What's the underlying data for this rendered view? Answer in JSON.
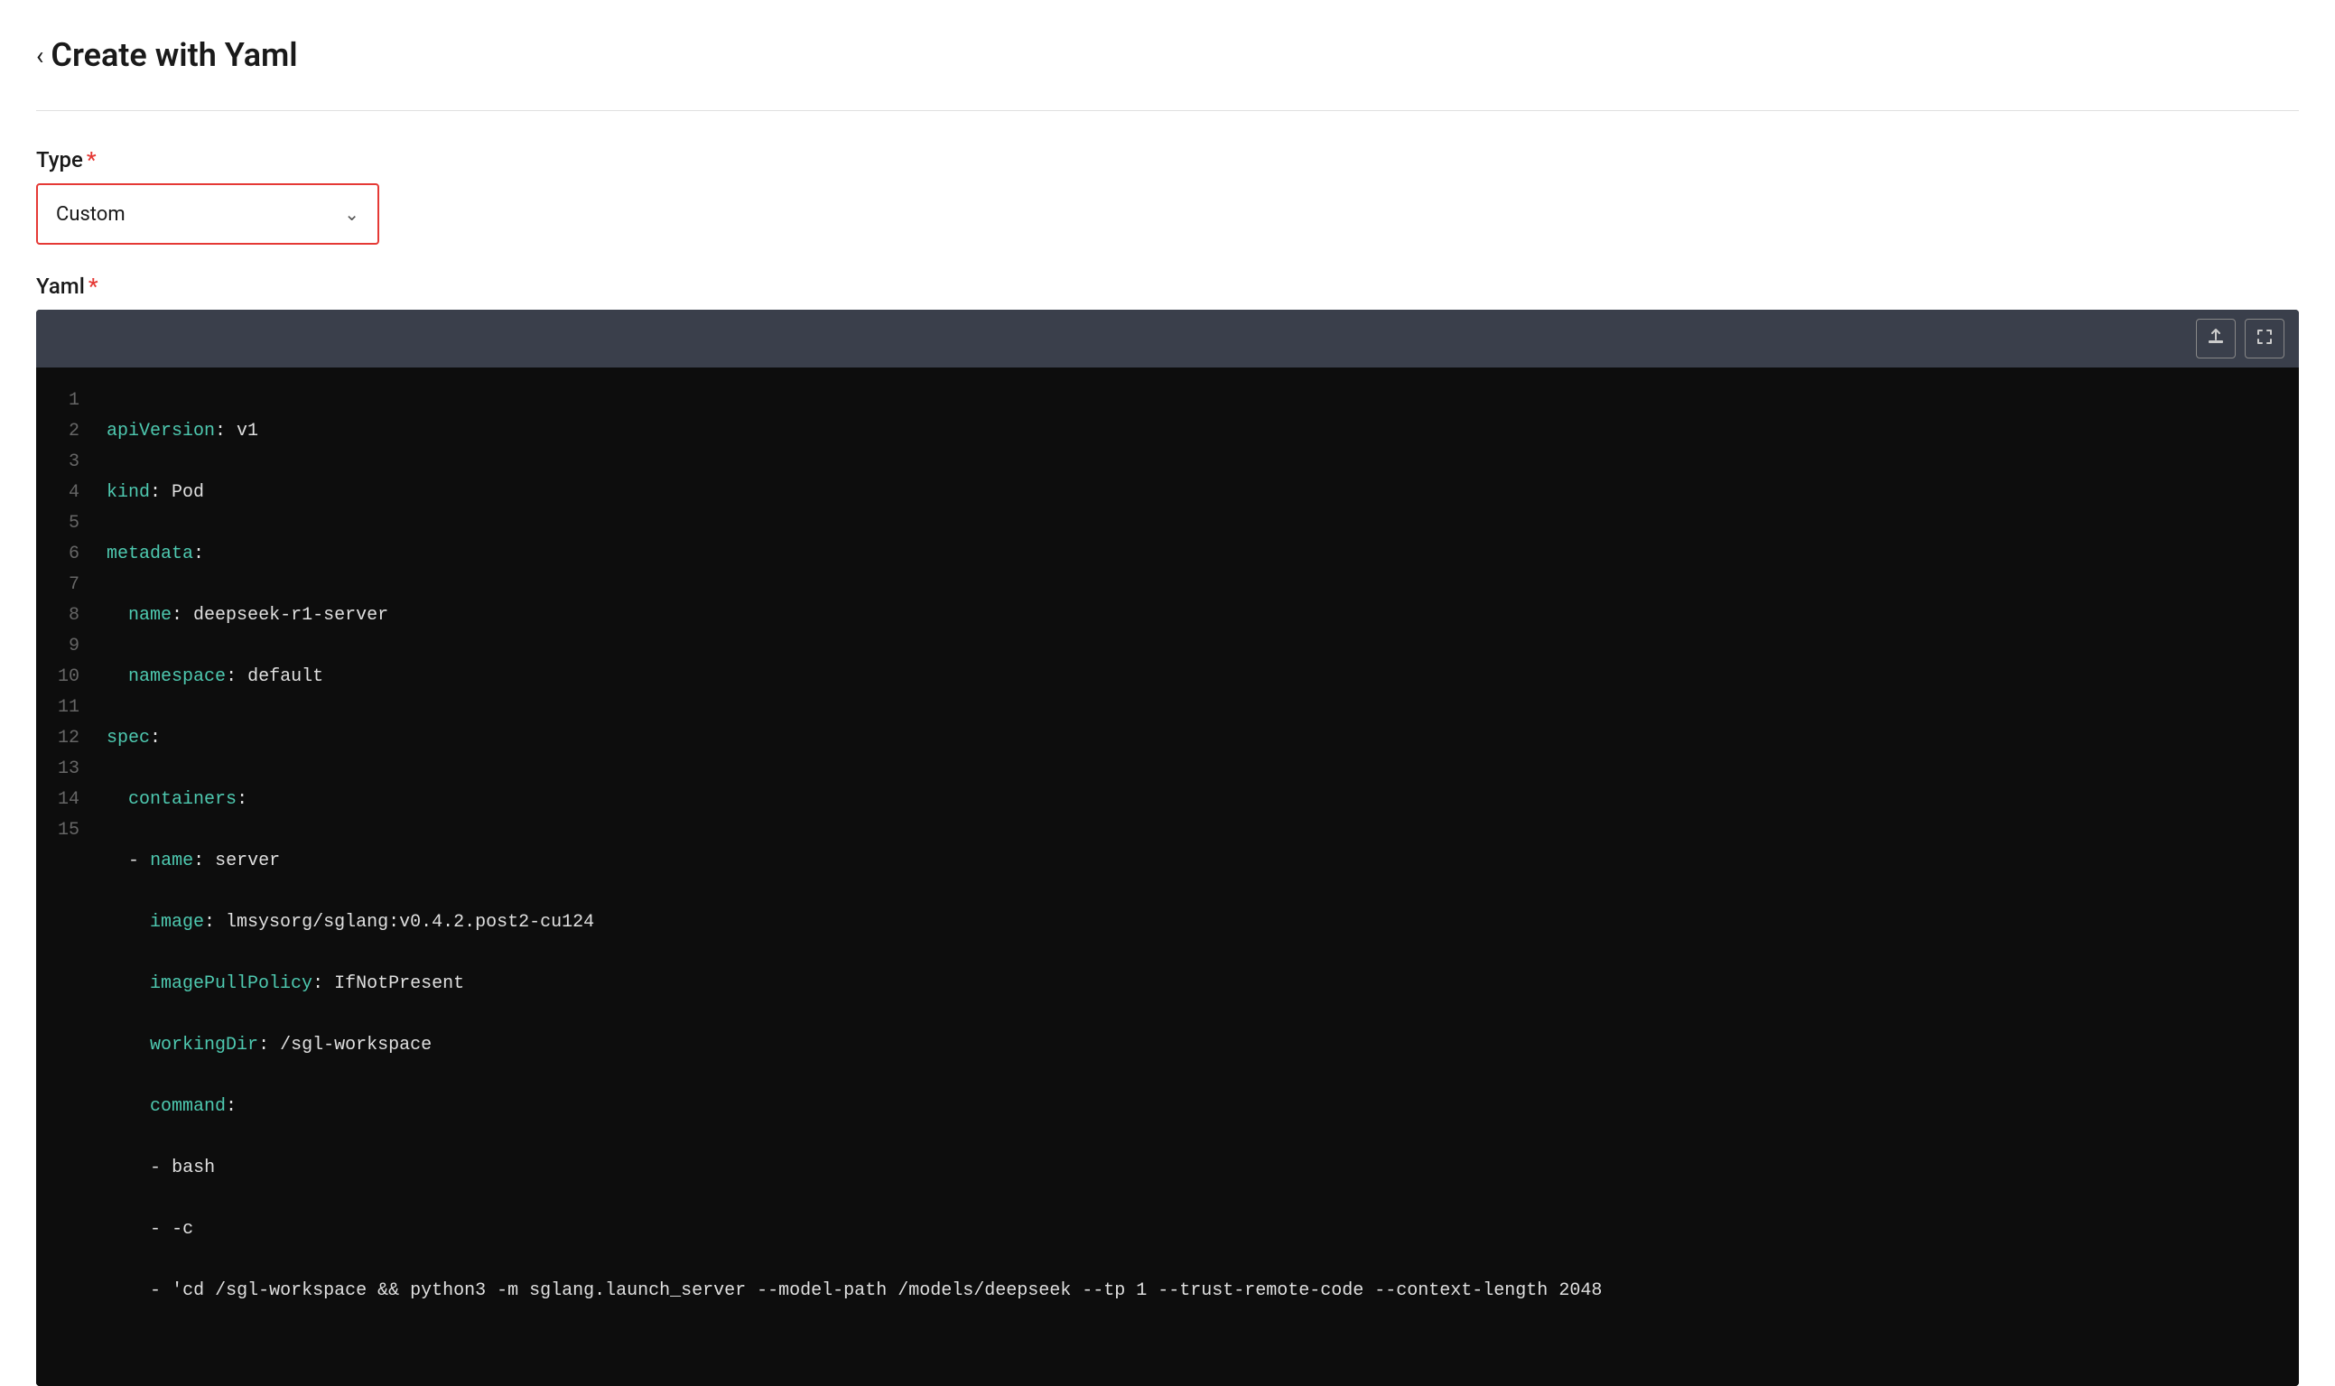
{
  "header": {
    "back_label": "‹",
    "title": "Create with Yaml"
  },
  "form": {
    "type_label": "Type",
    "type_required": "*",
    "type_value": "Custom",
    "type_chevron": "∨",
    "yaml_label": "Yaml",
    "yaml_required": "*"
  },
  "toolbar": {
    "upload_icon": "upload-icon",
    "expand_icon": "expand-icon"
  },
  "editor": {
    "lines": [
      {
        "num": "1",
        "code": "apiVersion: v1"
      },
      {
        "num": "2",
        "code": "kind: Pod"
      },
      {
        "num": "3",
        "code": "metadata:"
      },
      {
        "num": "4",
        "code": "  name: deepseek-r1-server"
      },
      {
        "num": "5",
        "code": "  namespace: default"
      },
      {
        "num": "6",
        "code": "spec:"
      },
      {
        "num": "7",
        "code": "  containers:"
      },
      {
        "num": "8",
        "code": "  - name: server"
      },
      {
        "num": "9",
        "code": "    image: lmsysorg/sglang:v0.4.2.post2-cu124"
      },
      {
        "num": "10",
        "code": "    imagePullPolicy: IfNotPresent"
      },
      {
        "num": "11",
        "code": "    workingDir: /sgl-workspace"
      },
      {
        "num": "12",
        "code": "    command:"
      },
      {
        "num": "13",
        "code": "    - bash"
      },
      {
        "num": "14",
        "code": "    - -c"
      },
      {
        "num": "15",
        "code": "    - 'cd /sgl-workspace && python3 -m sglang.launch_server --model-path /models/deepseek --tp 1 --trust-remote-code --context-length 2048"
      }
    ]
  }
}
